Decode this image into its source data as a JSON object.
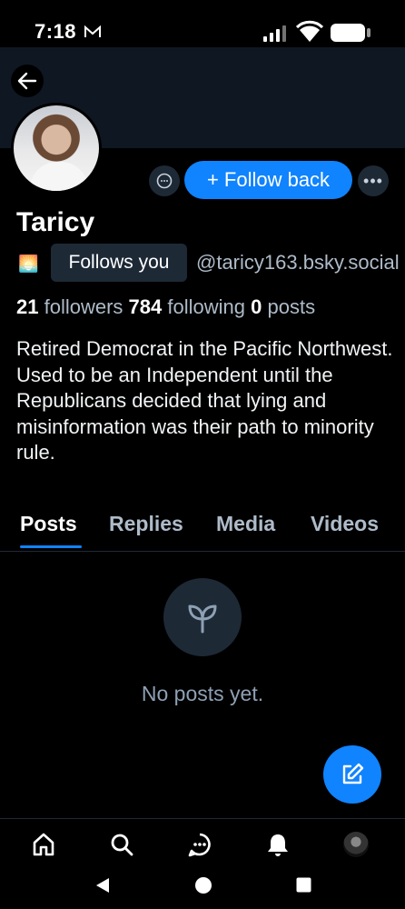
{
  "status_bar": {
    "time": "7:18",
    "mail_icon": "mail-icon",
    "signal_icon": "signal-icon",
    "wifi_icon": "wifi-icon",
    "battery_icon": "battery-icon"
  },
  "header": {
    "back_icon": "arrow-left-icon"
  },
  "profile": {
    "display_name": "Taricy",
    "follows_you_label": "Follows you",
    "handle": "@taricy163.bsky.social",
    "stats": {
      "followers_count": "21",
      "followers_label": "followers",
      "following_count": "784",
      "following_label": "following",
      "posts_count": "0",
      "posts_label": "posts"
    },
    "bio": "Retired Democrat in the Pacific Northwest. Used to be an Independent until the Republicans decided that lying and misinformation was their path to minority rule."
  },
  "actions": {
    "message_icon": "chat-icon",
    "follow_back_label": "+ Follow back",
    "more_icon": "ellipsis-icon"
  },
  "tabs": [
    {
      "label": "Posts",
      "active": true
    },
    {
      "label": "Replies",
      "active": false
    },
    {
      "label": "Media",
      "active": false
    },
    {
      "label": "Videos",
      "active": false
    }
  ],
  "empty_state": {
    "icon": "sprout-icon",
    "text": "No posts yet."
  },
  "fab": {
    "icon": "compose-icon"
  },
  "bottom_nav": [
    "home-icon",
    "search-icon",
    "chat-icon",
    "bell-icon",
    "avatar"
  ],
  "system_nav": [
    "back-triangle-icon",
    "home-circle-icon",
    "recents-square-icon"
  ],
  "colors": {
    "accent": "#1083fe",
    "background": "#000000",
    "muted": "#aebbc9",
    "surface": "#1e2936"
  }
}
